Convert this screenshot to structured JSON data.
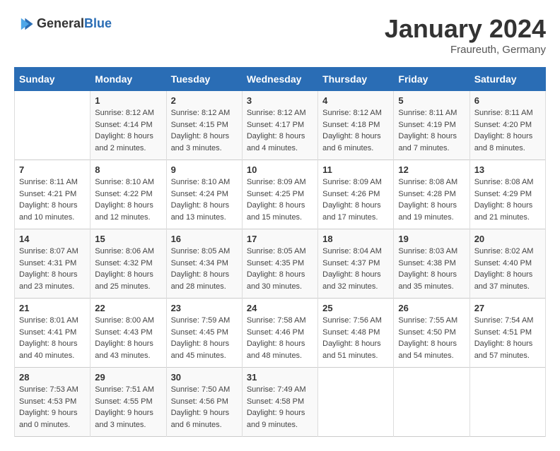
{
  "logo": {
    "general": "General",
    "blue": "Blue"
  },
  "title": "January 2024",
  "subtitle": "Fraureuth, Germany",
  "days_header": [
    "Sunday",
    "Monday",
    "Tuesday",
    "Wednesday",
    "Thursday",
    "Friday",
    "Saturday"
  ],
  "weeks": [
    [
      {
        "day": "",
        "sunrise": "",
        "sunset": "",
        "daylight": ""
      },
      {
        "day": "1",
        "sunrise": "Sunrise: 8:12 AM",
        "sunset": "Sunset: 4:14 PM",
        "daylight": "Daylight: 8 hours and 2 minutes."
      },
      {
        "day": "2",
        "sunrise": "Sunrise: 8:12 AM",
        "sunset": "Sunset: 4:15 PM",
        "daylight": "Daylight: 8 hours and 3 minutes."
      },
      {
        "day": "3",
        "sunrise": "Sunrise: 8:12 AM",
        "sunset": "Sunset: 4:17 PM",
        "daylight": "Daylight: 8 hours and 4 minutes."
      },
      {
        "day": "4",
        "sunrise": "Sunrise: 8:12 AM",
        "sunset": "Sunset: 4:18 PM",
        "daylight": "Daylight: 8 hours and 6 minutes."
      },
      {
        "day": "5",
        "sunrise": "Sunrise: 8:11 AM",
        "sunset": "Sunset: 4:19 PM",
        "daylight": "Daylight: 8 hours and 7 minutes."
      },
      {
        "day": "6",
        "sunrise": "Sunrise: 8:11 AM",
        "sunset": "Sunset: 4:20 PM",
        "daylight": "Daylight: 8 hours and 8 minutes."
      }
    ],
    [
      {
        "day": "7",
        "sunrise": "Sunrise: 8:11 AM",
        "sunset": "Sunset: 4:21 PM",
        "daylight": "Daylight: 8 hours and 10 minutes."
      },
      {
        "day": "8",
        "sunrise": "Sunrise: 8:10 AM",
        "sunset": "Sunset: 4:22 PM",
        "daylight": "Daylight: 8 hours and 12 minutes."
      },
      {
        "day": "9",
        "sunrise": "Sunrise: 8:10 AM",
        "sunset": "Sunset: 4:24 PM",
        "daylight": "Daylight: 8 hours and 13 minutes."
      },
      {
        "day": "10",
        "sunrise": "Sunrise: 8:09 AM",
        "sunset": "Sunset: 4:25 PM",
        "daylight": "Daylight: 8 hours and 15 minutes."
      },
      {
        "day": "11",
        "sunrise": "Sunrise: 8:09 AM",
        "sunset": "Sunset: 4:26 PM",
        "daylight": "Daylight: 8 hours and 17 minutes."
      },
      {
        "day": "12",
        "sunrise": "Sunrise: 8:08 AM",
        "sunset": "Sunset: 4:28 PM",
        "daylight": "Daylight: 8 hours and 19 minutes."
      },
      {
        "day": "13",
        "sunrise": "Sunrise: 8:08 AM",
        "sunset": "Sunset: 4:29 PM",
        "daylight": "Daylight: 8 hours and 21 minutes."
      }
    ],
    [
      {
        "day": "14",
        "sunrise": "Sunrise: 8:07 AM",
        "sunset": "Sunset: 4:31 PM",
        "daylight": "Daylight: 8 hours and 23 minutes."
      },
      {
        "day": "15",
        "sunrise": "Sunrise: 8:06 AM",
        "sunset": "Sunset: 4:32 PM",
        "daylight": "Daylight: 8 hours and 25 minutes."
      },
      {
        "day": "16",
        "sunrise": "Sunrise: 8:05 AM",
        "sunset": "Sunset: 4:34 PM",
        "daylight": "Daylight: 8 hours and 28 minutes."
      },
      {
        "day": "17",
        "sunrise": "Sunrise: 8:05 AM",
        "sunset": "Sunset: 4:35 PM",
        "daylight": "Daylight: 8 hours and 30 minutes."
      },
      {
        "day": "18",
        "sunrise": "Sunrise: 8:04 AM",
        "sunset": "Sunset: 4:37 PM",
        "daylight": "Daylight: 8 hours and 32 minutes."
      },
      {
        "day": "19",
        "sunrise": "Sunrise: 8:03 AM",
        "sunset": "Sunset: 4:38 PM",
        "daylight": "Daylight: 8 hours and 35 minutes."
      },
      {
        "day": "20",
        "sunrise": "Sunrise: 8:02 AM",
        "sunset": "Sunset: 4:40 PM",
        "daylight": "Daylight: 8 hours and 37 minutes."
      }
    ],
    [
      {
        "day": "21",
        "sunrise": "Sunrise: 8:01 AM",
        "sunset": "Sunset: 4:41 PM",
        "daylight": "Daylight: 8 hours and 40 minutes."
      },
      {
        "day": "22",
        "sunrise": "Sunrise: 8:00 AM",
        "sunset": "Sunset: 4:43 PM",
        "daylight": "Daylight: 8 hours and 43 minutes."
      },
      {
        "day": "23",
        "sunrise": "Sunrise: 7:59 AM",
        "sunset": "Sunset: 4:45 PM",
        "daylight": "Daylight: 8 hours and 45 minutes."
      },
      {
        "day": "24",
        "sunrise": "Sunrise: 7:58 AM",
        "sunset": "Sunset: 4:46 PM",
        "daylight": "Daylight: 8 hours and 48 minutes."
      },
      {
        "day": "25",
        "sunrise": "Sunrise: 7:56 AM",
        "sunset": "Sunset: 4:48 PM",
        "daylight": "Daylight: 8 hours and 51 minutes."
      },
      {
        "day": "26",
        "sunrise": "Sunrise: 7:55 AM",
        "sunset": "Sunset: 4:50 PM",
        "daylight": "Daylight: 8 hours and 54 minutes."
      },
      {
        "day": "27",
        "sunrise": "Sunrise: 7:54 AM",
        "sunset": "Sunset: 4:51 PM",
        "daylight": "Daylight: 8 hours and 57 minutes."
      }
    ],
    [
      {
        "day": "28",
        "sunrise": "Sunrise: 7:53 AM",
        "sunset": "Sunset: 4:53 PM",
        "daylight": "Daylight: 9 hours and 0 minutes."
      },
      {
        "day": "29",
        "sunrise": "Sunrise: 7:51 AM",
        "sunset": "Sunset: 4:55 PM",
        "daylight": "Daylight: 9 hours and 3 minutes."
      },
      {
        "day": "30",
        "sunrise": "Sunrise: 7:50 AM",
        "sunset": "Sunset: 4:56 PM",
        "daylight": "Daylight: 9 hours and 6 minutes."
      },
      {
        "day": "31",
        "sunrise": "Sunrise: 7:49 AM",
        "sunset": "Sunset: 4:58 PM",
        "daylight": "Daylight: 9 hours and 9 minutes."
      },
      {
        "day": "",
        "sunrise": "",
        "sunset": "",
        "daylight": ""
      },
      {
        "day": "",
        "sunrise": "",
        "sunset": "",
        "daylight": ""
      },
      {
        "day": "",
        "sunrise": "",
        "sunset": "",
        "daylight": ""
      }
    ]
  ]
}
